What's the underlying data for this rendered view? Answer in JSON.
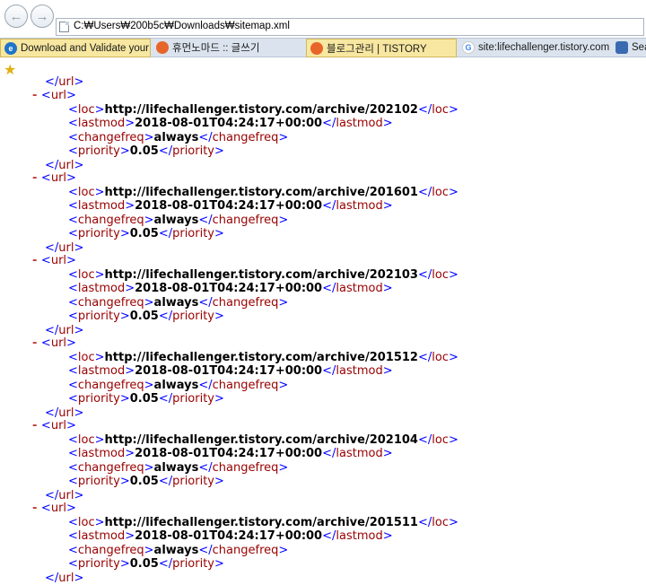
{
  "address_bar": {
    "url": "C:₩Users₩200b5c₩Downloads₩sitemap.xml"
  },
  "favorites": [
    {
      "label": "Download and Validate your ...",
      "icon": "ie-icon",
      "color": "#1e74c8"
    },
    {
      "label": "휴먼노마드 :: 글쓰기",
      "icon": "orange-circle-icon",
      "color": "#e8652a"
    },
    {
      "label": "블로그관리 | TISTORY",
      "icon": "orange-circle-icon",
      "color": "#e8652a"
    },
    {
      "label": "site:lifechallenger.tistory.com ...",
      "icon": "google-icon",
      "color": "#4285f4"
    },
    {
      "label": "Sea",
      "icon": "shield-icon",
      "color": "#3a6bb0"
    }
  ],
  "xml": {
    "url_tag": "url",
    "loc_tag": "loc",
    "lastmod_tag": "lastmod",
    "changefreq_tag": "changefreq",
    "priority_tag": "priority",
    "lastmod": "2018-08-01T04:24:17+00:00",
    "changefreq": "always",
    "priority": "0.05",
    "collapse_marker": "-",
    "entries": [
      "http://lifechallenger.tistory.com/archive/202102",
      "http://lifechallenger.tistory.com/archive/201601",
      "http://lifechallenger.tistory.com/archive/202103",
      "http://lifechallenger.tistory.com/archive/201512",
      "http://lifechallenger.tistory.com/archive/202104",
      "http://lifechallenger.tistory.com/archive/201511"
    ]
  }
}
